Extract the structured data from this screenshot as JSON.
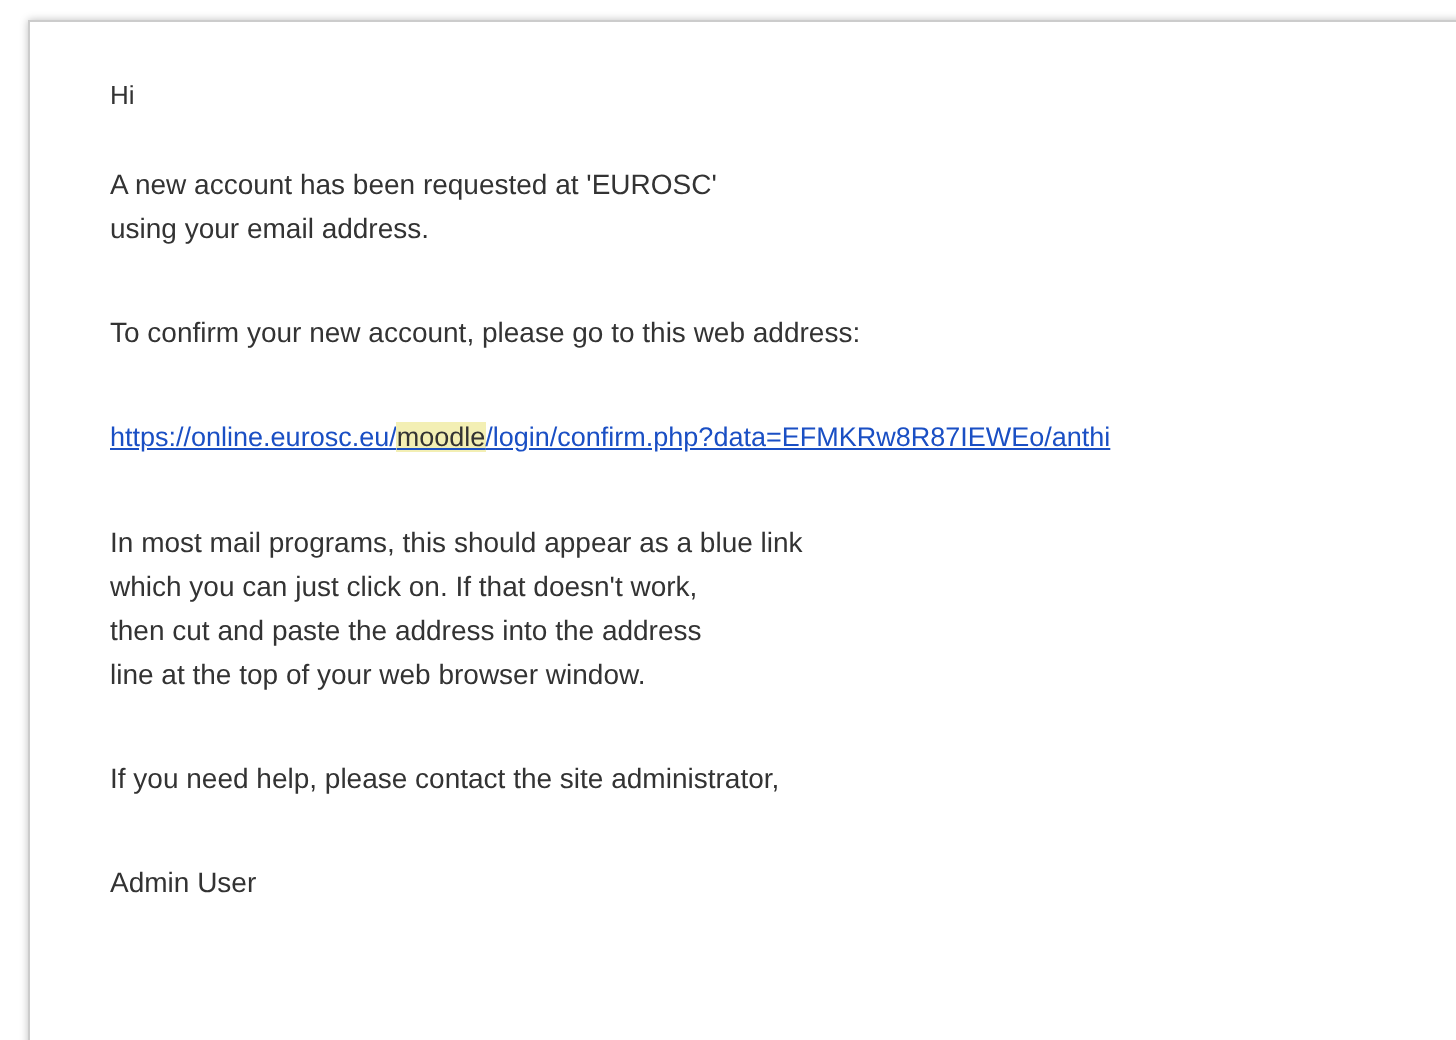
{
  "email": {
    "greeting": "Hi",
    "paragraphs": [
      {
        "kind": "text",
        "lines": [
          "A new account has been requested at 'EUROSC'",
          "using your email address."
        ]
      },
      {
        "kind": "text",
        "lines": [
          "To confirm your new account, please go to this web address:"
        ]
      },
      {
        "kind": "link",
        "before": "https://online.eurosc.eu/",
        "highlight": "moodle",
        "after": "/login/confirm.php?data=EFMKRw8R87IEWEo/anthi"
      },
      {
        "kind": "text",
        "lines": [
          "In most mail programs, this should appear as a blue link",
          "which you can just click on. If that doesn't work,",
          "then cut and paste the address into the address",
          "line at the top of your web browser window."
        ]
      },
      {
        "kind": "text",
        "lines": [
          "If you need help, please contact the site administrator,"
        ]
      },
      {
        "kind": "text",
        "lines": [
          "Admin User"
        ]
      }
    ]
  }
}
